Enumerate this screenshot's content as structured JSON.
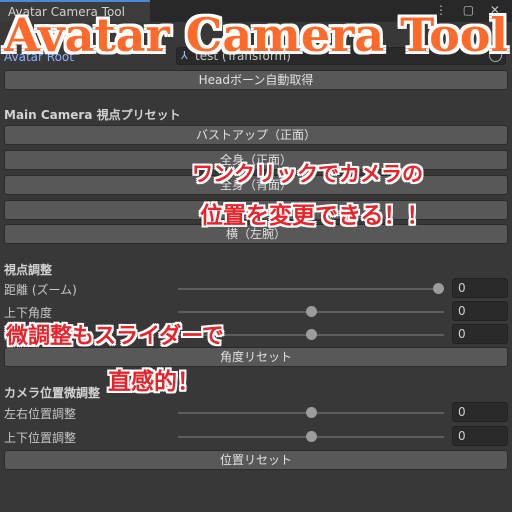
{
  "window": {
    "tab_title": "Avatar Camera Tool",
    "tab_icons": "⋮ ▢ ✕"
  },
  "headline": "Avatar Camera Tool",
  "avatar": {
    "label": "Avatar Root",
    "value": "test (Transform)",
    "head_button": "Headボーン自動取得"
  },
  "presets": {
    "section_title": "Main Camera 視点プリセット",
    "buttons": [
      "バストアップ（正面）",
      "全身（正面）",
      "全身（背面）",
      "",
      "横（左腕）"
    ]
  },
  "view_adjust": {
    "section_title": "視点調整",
    "sliders": [
      {
        "label": "距離 (ズーム)",
        "value": "0",
        "level": 1.0
      },
      {
        "label": "上下角度",
        "value": "0",
        "level": 0.5
      },
      {
        "label": "左右角度",
        "value": "0",
        "level": 0.5
      }
    ],
    "reset_button": "角度リセット"
  },
  "position_adjust": {
    "section_title": "カメラ位置微調整",
    "sliders": [
      {
        "label": "左右位置調整",
        "value": "0",
        "level": 0.5
      },
      {
        "label": "上下位置調整",
        "value": "0",
        "level": 0.5
      }
    ],
    "reset_button": "位置リセット"
  },
  "callouts": {
    "one_click_line1": "ワンクリックでカメラの",
    "one_click_line2": "位置を変更できる！！",
    "slider_line1": "微調整もスライダーで",
    "slider_line2": "直感的！"
  },
  "colors": {
    "headline": "#ff6a2a",
    "callout": "#e8242a",
    "panel_bg": "#383838",
    "button_bg": "#585858"
  }
}
